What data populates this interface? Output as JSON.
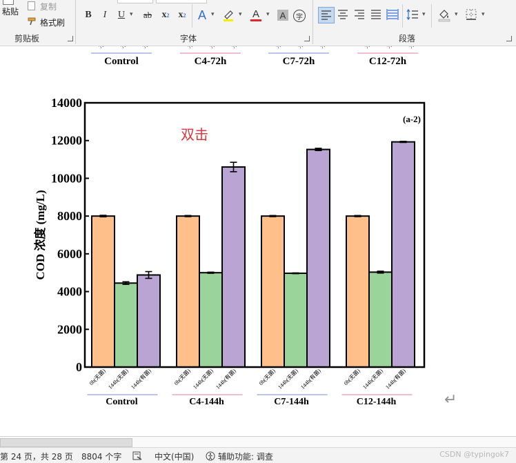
{
  "ribbon": {
    "clipboard": {
      "paste": "粘贴",
      "copy": "复制",
      "format_painter": "格式刷",
      "group": "剪贴板"
    },
    "font": {
      "group": "字体",
      "bold": "B",
      "italic": "I",
      "underline": "U",
      "strike": "ab",
      "subscript": "x",
      "superscript": "x",
      "text_effects": "A",
      "font_color": "A",
      "char_shading": "A",
      "enclose": "字"
    },
    "paragraph": {
      "group": "段落"
    }
  },
  "top_chart_fragment": {
    "categories": [
      "Control",
      "C4-72h",
      "C7-72h",
      "C12-72h"
    ],
    "tick_stub": "72"
  },
  "chart_data": {
    "type": "bar",
    "panel_label": "(a-2)",
    "ylabel": "COD 浓度 (mg/L)",
    "ylim": [
      0,
      14000
    ],
    "yticks": [
      0,
      2000,
      4000,
      6000,
      8000,
      10000,
      12000,
      14000
    ],
    "categories": [
      "Control",
      "C4-144h",
      "C7-144h",
      "C12-144h"
    ],
    "series": [
      {
        "name": "0h(无菌)",
        "color": "#ffbf8a",
        "values": [
          8000,
          8000,
          8000,
          8000
        ],
        "errors": [
          40,
          30,
          30,
          30
        ]
      },
      {
        "name": "144h(无菌)",
        "color": "#9ad49a",
        "values": [
          4450,
          5000,
          4970,
          5030
        ],
        "errors": [
          70,
          30,
          20,
          50
        ]
      },
      {
        "name": "144h(有菌)",
        "color": "#b9a4d4",
        "values": [
          4880,
          10600,
          11530,
          11930
        ],
        "errors": [
          180,
          250,
          60,
          30
        ]
      }
    ]
  },
  "annotation": {
    "text": "双击",
    "color": "#e0363c"
  },
  "paragraph_mark": "↵",
  "status": {
    "page": "第 24 页，共 28 页",
    "words": "8804 个字",
    "language": "中文(中国)",
    "accessibility": "辅助功能: 调查"
  },
  "watermark": "CSDN @typingok7"
}
